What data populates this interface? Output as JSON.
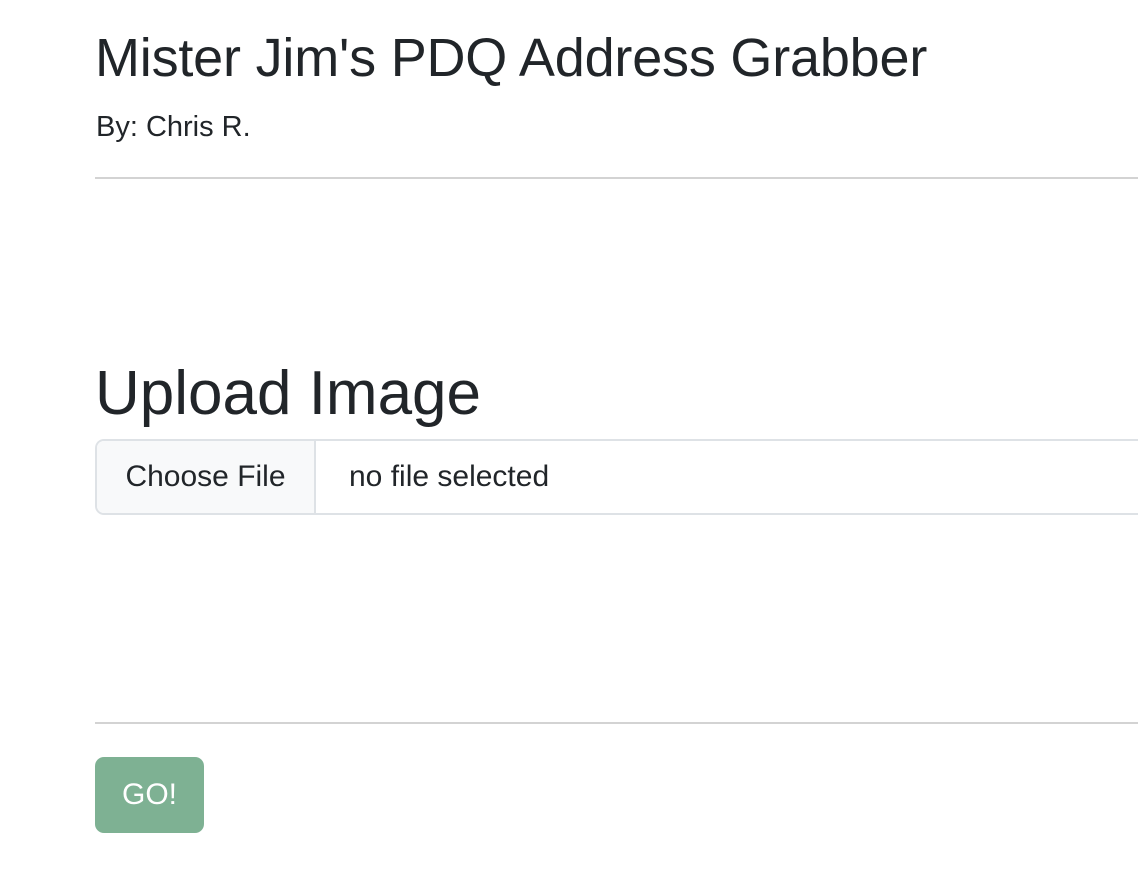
{
  "header": {
    "title": "Mister Jim's PDQ Address Grabber",
    "byline": "By: Chris R."
  },
  "upload": {
    "heading": "Upload Image",
    "choose_file_label": "Choose File",
    "status_text": "no file selected"
  },
  "actions": {
    "go_label": "GO!"
  },
  "colors": {
    "go_button_bg": "#7eb193",
    "text": "#212529",
    "divider": "#d3d3d3",
    "file_button_bg": "#f8f9fa"
  }
}
